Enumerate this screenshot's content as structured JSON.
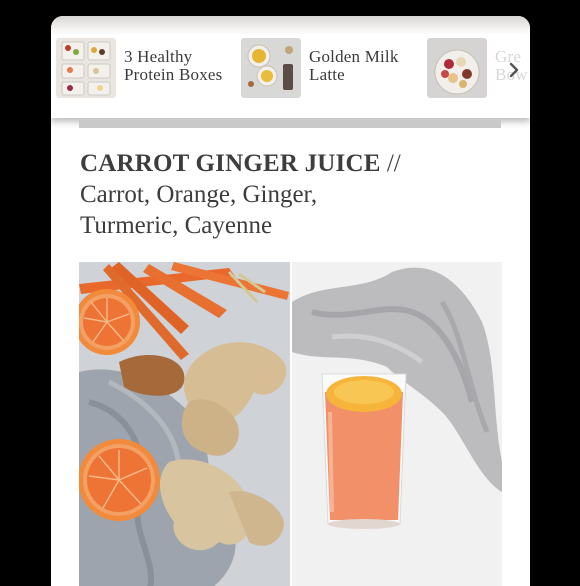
{
  "related_carousel": {
    "items": [
      {
        "title_line1": "3 Healthy",
        "title_line2": "Protein Boxes"
      },
      {
        "title_line1": "Golden Milk",
        "title_line2": "Latte"
      },
      {
        "title_line1": "Gre",
        "title_line2": "Bow"
      }
    ],
    "next_icon": "chevron-right-icon"
  },
  "article": {
    "title_bold": "CARROT GINGER JUICE",
    "title_separator": " // ",
    "title_rest_line1": "Carrot, Orange, Ginger,",
    "title_rest_line2": "Turmeric, Cayenne"
  },
  "photos": {
    "left_subject": "carrots-orange-ginger-photo",
    "right_subject": "juice-glass-photo"
  },
  "colors": {
    "heading": "#3d3d3d",
    "carrot": "#e86a2a",
    "orange": "#f07a36",
    "juice": "#f2905e",
    "cloth": "#b8bcc3"
  }
}
